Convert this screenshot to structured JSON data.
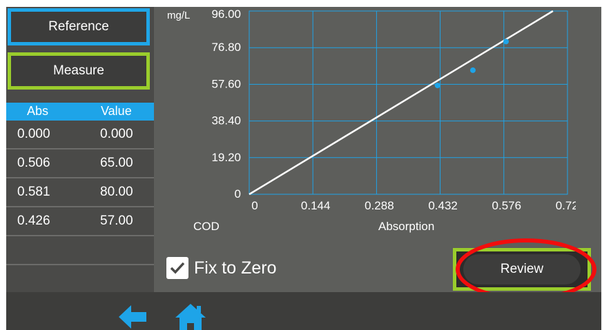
{
  "buttons": {
    "reference": "Reference",
    "measure": "Measure",
    "review": "Review"
  },
  "table": {
    "headers": [
      "Abs",
      "Value"
    ],
    "rows": [
      [
        "0.000",
        "0.000"
      ],
      [
        "0.506",
        "65.00"
      ],
      [
        "0.581",
        "80.00"
      ],
      [
        "0.426",
        "57.00"
      ],
      [
        "",
        ""
      ],
      [
        "",
        ""
      ]
    ]
  },
  "fix_to_zero": {
    "label": "Fix to Zero",
    "checked": true
  },
  "chart_data": {
    "type": "scatter",
    "title": "COD",
    "ylabel": "mg/L",
    "xlabel": "Absorption",
    "y_ticks": [
      "96.00",
      "76.80",
      "57.60",
      "38.40",
      "19.20",
      "0"
    ],
    "x_ticks": [
      "0",
      "0.144",
      "0.288",
      "0.432",
      "0.576",
      "0.720"
    ],
    "xlim": [
      0,
      0.72
    ],
    "ylim": [
      0,
      96
    ],
    "points": [
      {
        "x": 0.0,
        "y": 0.0
      },
      {
        "x": 0.506,
        "y": 65.0
      },
      {
        "x": 0.581,
        "y": 80.0
      },
      {
        "x": 0.426,
        "y": 57.0
      }
    ],
    "fit_line": {
      "x": [
        0,
        0.72
      ],
      "y": [
        0,
        100.6
      ]
    },
    "grid": true,
    "colors": {
      "grid": "#1ea4e8",
      "points": "#1ea4e8",
      "line": "#ffffff"
    }
  },
  "nav": {
    "back": "arrow-left-icon",
    "home": "home-icon"
  },
  "colors": {
    "accent_blue": "#1ea4e8",
    "accent_green": "#9acd2c",
    "highlight_red": "#f20d0d"
  }
}
